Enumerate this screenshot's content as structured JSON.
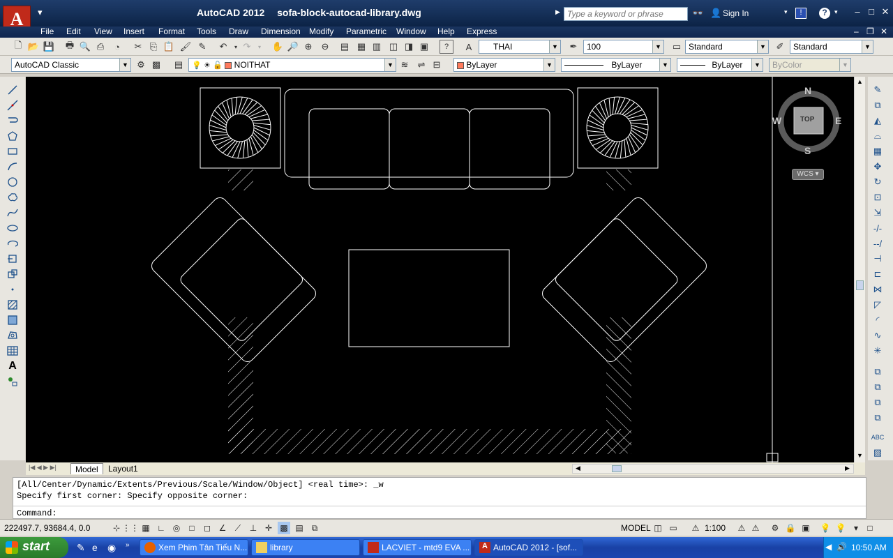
{
  "window": {
    "app_name": "AutoCAD 2012",
    "file_name": "sofa-block-autocad-library.dwg",
    "search_placeholder": "Type a keyword or phrase",
    "sign_in": "Sign In"
  },
  "menu": [
    "File",
    "Edit",
    "View",
    "Insert",
    "Format",
    "Tools",
    "Draw",
    "Dimension",
    "Modify",
    "Parametric",
    "Window",
    "Help",
    "Express"
  ],
  "toolbar": {
    "text_style": "THAI",
    "text_height": "100",
    "dim_style": "Standard",
    "table_style": "Standard",
    "workspace": "AutoCAD Classic",
    "layer": "NOITHAT",
    "color": "ByLayer",
    "linetype": "ByLayer",
    "lineweight": "ByLayer",
    "plot_style": "ByColor"
  },
  "viewcube": {
    "north": "N",
    "south": "S",
    "east": "E",
    "west": "W",
    "face": "TOP",
    "ucs": "WCS"
  },
  "layout_tabs": [
    "Model",
    "Layout1"
  ],
  "command": {
    "history_1": "[All/Center/Dynamic/Extents/Previous/Scale/Window/Object] <real time>: _w",
    "history_2": "Specify first corner: Specify opposite corner:",
    "prompt": "Command:"
  },
  "status": {
    "coordinates": "222497.7, 93684.4, 0.0",
    "space": "MODEL",
    "annotation_scale": "1:100"
  },
  "taskbar": {
    "start": "start",
    "tasks": [
      "Xem Phim Tân Tiếu N...",
      "library",
      "LACVIET - mtd9 EVA ...",
      "AutoCAD 2012 - [sof..."
    ],
    "clock": "10:50 AM"
  },
  "colors": {
    "canvas": "#000000",
    "title_bar": "#1f3d6b",
    "taskbar": "#245edb",
    "start_button": "#3c9a3c",
    "drawing_lines": "#ffffff",
    "layer_swatch": "#ff7a5c"
  },
  "icons": [
    "autocad-logo",
    "binoculars-icon",
    "user-icon",
    "help-icon",
    "warning-icon"
  ]
}
